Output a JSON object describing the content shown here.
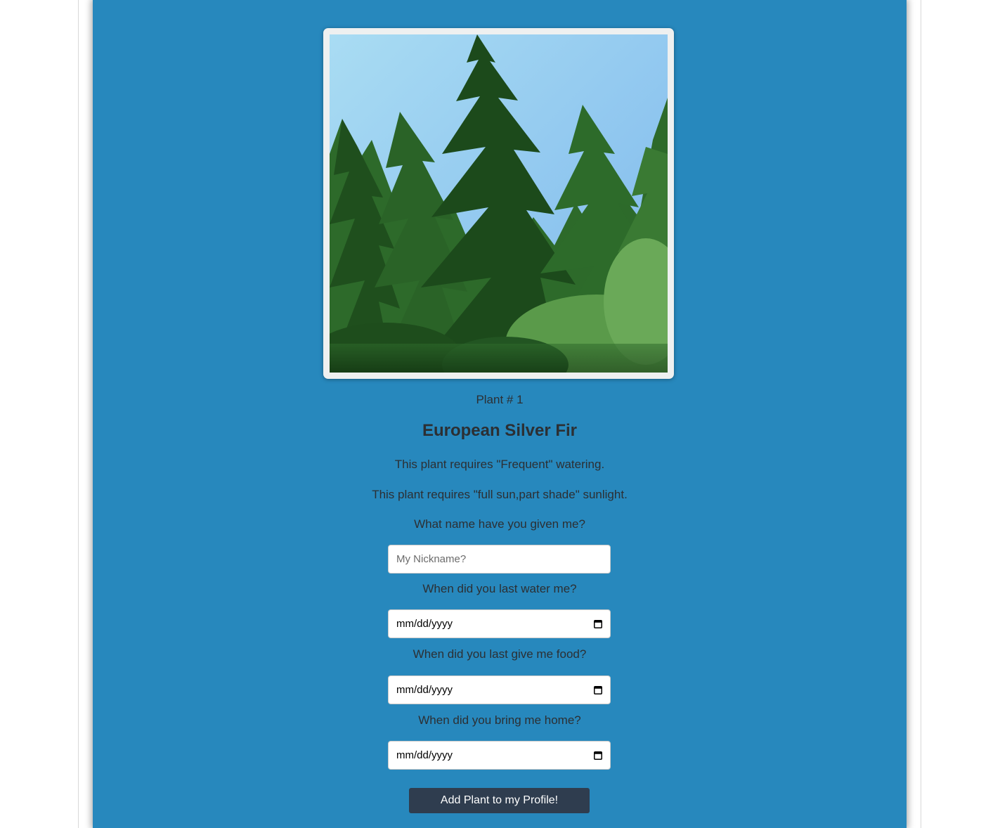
{
  "plant": {
    "number_label": "Plant # 1",
    "name": "European Silver Fir",
    "watering_text": "This plant requires \"Frequent\" watering.",
    "sunlight_text": "This plant requires \"full sun,part shade\" sunlight."
  },
  "form": {
    "nickname_question": "What name have you given me?",
    "nickname_placeholder": "My Nickname?",
    "water_question": "When did you last water me?",
    "water_date_value": "mm/dd/yyyy",
    "food_question": "When did you last give me food?",
    "food_date_value": "mm/dd/yyyy",
    "home_question": "When did you bring me home?",
    "home_date_value": "mm/dd/yyyy",
    "submit_label": "Add Plant to my Profile!"
  },
  "colors": {
    "card_background": "#2788bd",
    "button_background": "#2f3d4f",
    "text": "#2c2f33"
  },
  "icons": {
    "date_picker": "calendar-icon"
  }
}
